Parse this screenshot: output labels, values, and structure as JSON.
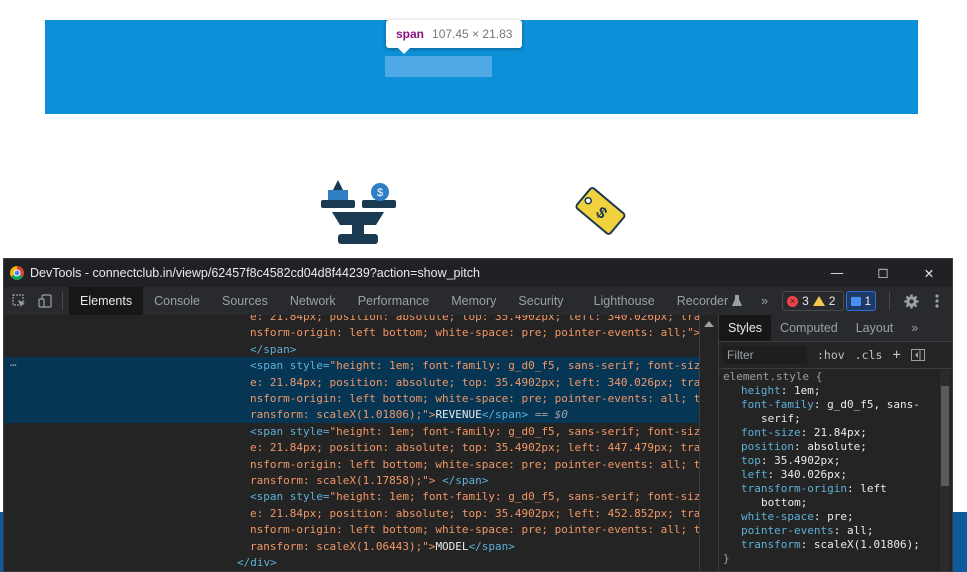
{
  "inspect_tooltip": {
    "tag": "span",
    "dimensions": "107.45 × 21.83"
  },
  "window": {
    "title": "DevTools - connectclub.in/viewp/62457f8c4582cd04d8f44239?action=show_pitch",
    "minimize": "—",
    "maximize": "☐",
    "close": "✕"
  },
  "tabs": [
    "Elements",
    "Console",
    "Sources",
    "Network",
    "Performance",
    "Memory",
    "Security",
    "Lighthouse",
    "Recorder"
  ],
  "more_tabs": "»",
  "issues": {
    "errors": "3",
    "warnings": "2",
    "messages": "1"
  },
  "icons": {
    "settings": "gear-icon",
    "menu": "kebab-icon",
    "inspect": "select-element-icon",
    "device": "device-toolbar-icon"
  },
  "elements": {
    "lines": [
      {
        "indent": "        ",
        "tag_open": "",
        "text": "e: 21.84px; position: absolute; top: 35.4902px; left: 340.026px; tra"
      },
      {
        "indent": "        ",
        "tag_open": "",
        "text": "nsform-origin: left bottom; white-space: pre; pointer-events: all;\">"
      },
      {
        "indent": "        ",
        "tag_open": "</span>",
        "text": ""
      },
      {
        "indent": "        ",
        "tag_open": "<span style=",
        "text": "\"height: 1em; font-family: g_d0_f5, sans-serif; font-siz"
      },
      {
        "indent": "        ",
        "tag_open": "",
        "text": "e: 21.84px; position: absolute; top: 35.4902px; left: 340.026px; tra"
      },
      {
        "indent": "        ",
        "tag_open": "",
        "text": "nsform-origin: left bottom; white-space: pre; pointer-events: all; t"
      },
      {
        "indent": "        ",
        "tag_open": "",
        "text": "ransform: scaleX(1.01806);\">"
      },
      {
        "indent": "        ",
        "tag_open": "<span style=",
        "text": "\"height: 1em; font-family: g_d0_f5, sans-serif; font-siz"
      },
      {
        "indent": "        ",
        "tag_open": "",
        "text": "e: 21.84px; position: absolute; top: 35.4902px; left: 447.479px; tra"
      },
      {
        "indent": "        ",
        "tag_open": "",
        "text": "nsform-origin: left bottom; white-space: pre; pointer-events: all; t"
      },
      {
        "indent": "        ",
        "tag_open": "",
        "text": "ransform: scaleX(1.17858);\"> "
      },
      {
        "indent": "        ",
        "tag_open": "<span style=",
        "text": "\"height: 1em; font-family: g_d0_f5, sans-serif; font-siz"
      },
      {
        "indent": "        ",
        "tag_open": "",
        "text": "e: 21.84px; position: absolute; top: 35.4902px; left: 452.852px; tra"
      },
      {
        "indent": "        ",
        "tag_open": "",
        "text": "nsform-origin: left bottom; white-space: pre; pointer-events: all; t"
      },
      {
        "indent": "        ",
        "tag_open": "",
        "text": "ransform: scaleX(1.06443);\">"
      },
      {
        "indent": "      ",
        "tag_open": "</div>",
        "text": ""
      }
    ],
    "selected_text": "REVENUE",
    "selected_marker": "== $0",
    "model_text": "MODEL",
    "close_span": "</span>",
    "ellipsis": "…"
  },
  "styles": {
    "tabs": [
      "Styles",
      "Computed",
      "Layout"
    ],
    "filter_placeholder": "Filter",
    "hov": ":hov",
    "cls": ".cls",
    "plus": "+",
    "selector": "element.style {",
    "props": [
      {
        "name": "height",
        "value": "1em;"
      },
      {
        "name": "font-family",
        "value": "g_d0_f5, sans-"
      },
      {
        "name": "",
        "value": "serif;"
      },
      {
        "name": "font-size",
        "value": "21.84px;"
      },
      {
        "name": "position",
        "value": "absolute;"
      },
      {
        "name": "top",
        "value": "35.4902px;"
      },
      {
        "name": "left",
        "value": "340.026px;"
      },
      {
        "name": "transform-origin",
        "value": "left"
      },
      {
        "name": "",
        "value": "bottom;"
      },
      {
        "name": "white-space",
        "value": "pre;"
      },
      {
        "name": "pointer-events",
        "value": "all;"
      },
      {
        "name": "transform",
        "value": "scaleX(1.01806);"
      }
    ],
    "closing": "}"
  },
  "colors": {
    "banner": "#0e90d9",
    "selected_row": "#073655",
    "tag": "#5db0d7",
    "attr_value": "#f29766"
  }
}
